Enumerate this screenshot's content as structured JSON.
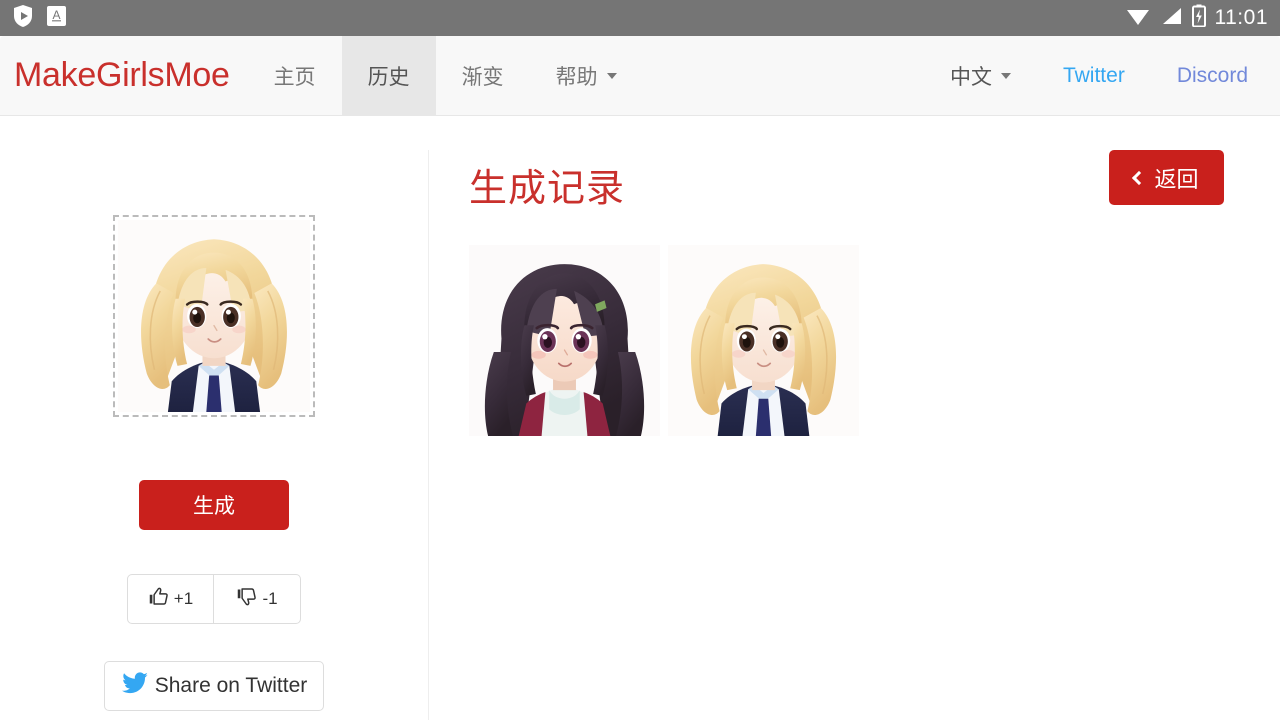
{
  "statusbar": {
    "icons": [
      "shield-play-icon",
      "translate-app-icon",
      "wifi-icon",
      "cellular-signal-icon",
      "battery-charging-icon"
    ],
    "time": "11:01",
    "background": "#757575"
  },
  "navbar": {
    "brand": "MakeGirlsMoe",
    "brand_color": "#c9302c",
    "items": [
      {
        "label": "主页",
        "active": false
      },
      {
        "label": "历史",
        "active": true
      },
      {
        "label": "渐变",
        "active": false
      },
      {
        "label": "帮助",
        "active": false,
        "has_caret": true
      }
    ],
    "right_items": [
      {
        "label": "中文",
        "has_caret": true,
        "color": "#555555"
      },
      {
        "label": "Twitter",
        "color": "#34a7f2"
      },
      {
        "label": "Discord",
        "color": "#7289da"
      }
    ]
  },
  "left_panel": {
    "preview_alt": "generated-anime-girl-blonde-twintails",
    "generate_label": "生成",
    "generate_color": "#c9201c",
    "upvote_label": "+1",
    "downvote_label": "-1",
    "share_label": "Share on Twitter",
    "twitter_color": "#34a7f2"
  },
  "right_panel": {
    "title": "生成记录",
    "title_color": "#c9302c",
    "back_label": "返回",
    "back_color": "#c9201c",
    "history": [
      {
        "alt": "history-thumbnail-dark-hair-girl"
      },
      {
        "alt": "history-thumbnail-blonde-twintails-girl"
      }
    ]
  }
}
